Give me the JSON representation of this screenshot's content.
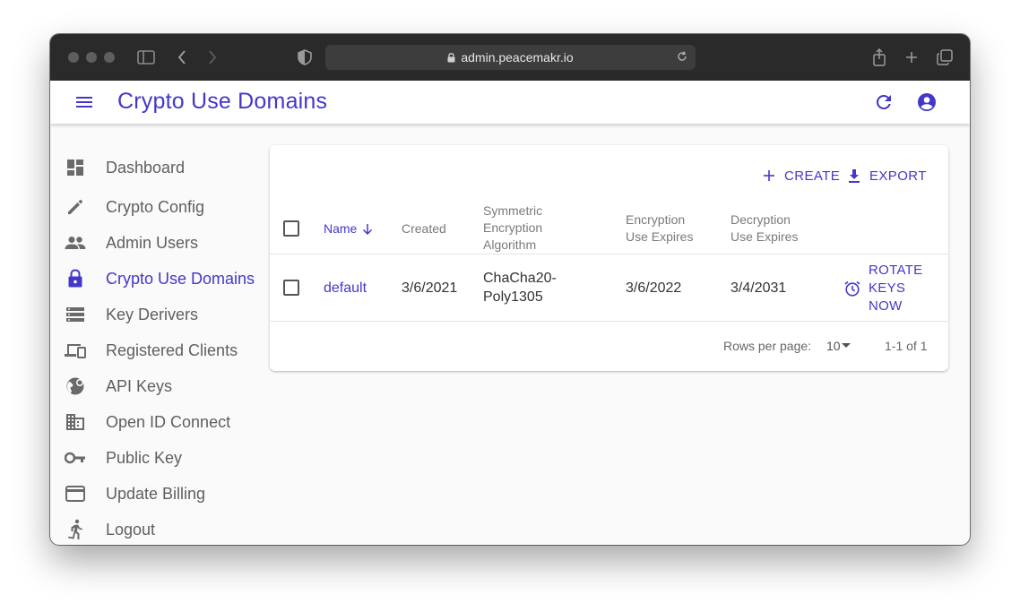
{
  "browser": {
    "url": "admin.peacemakr.io"
  },
  "appbar": {
    "title": "Crypto Use Domains"
  },
  "sidebar": {
    "items": [
      {
        "label": "Dashboard",
        "icon": "dashboard-icon",
        "active": false
      },
      {
        "label": "Crypto Config",
        "icon": "pencil-icon",
        "active": false
      },
      {
        "label": "Admin Users",
        "icon": "people-icon",
        "active": false
      },
      {
        "label": "Crypto Use Domains",
        "icon": "lock-icon",
        "active": true
      },
      {
        "label": "Key Derivers",
        "icon": "storage-icon",
        "active": false
      },
      {
        "label": "Registered Clients",
        "icon": "devices-icon",
        "active": false
      },
      {
        "label": "API Keys",
        "icon": "vpn-globe-icon",
        "active": false
      },
      {
        "label": "Open ID Connect",
        "icon": "business-icon",
        "active": false
      },
      {
        "label": "Public Key",
        "icon": "key-icon",
        "active": false
      },
      {
        "label": "Update Billing",
        "icon": "credit-card-icon",
        "active": false
      },
      {
        "label": "Logout",
        "icon": "running-person-icon",
        "active": false
      }
    ]
  },
  "toolbar": {
    "create_label": "CREATE",
    "export_label": "EXPORT"
  },
  "table": {
    "headers": {
      "name": "Name",
      "created": "Created",
      "algorithm_l1": "Symmetric",
      "algorithm_l2": "Encryption",
      "algorithm_l3": "Algorithm",
      "enc_l1": "Encryption",
      "enc_l2": "Use Expires",
      "dec_l1": "Decryption",
      "dec_l2": "Use Expires"
    },
    "rows": [
      {
        "name": "default",
        "created": "3/6/2021",
        "algorithm_l1": "ChaCha20-",
        "algorithm_l2": "Poly1305",
        "enc_expires": "3/6/2022",
        "dec_expires": "3/4/2031",
        "action_l1": "ROTATE",
        "action_l2": "KEYS",
        "action_l3": "NOW"
      }
    ],
    "footer": {
      "rows_per_page_label": "Rows per page:",
      "rows_per_page_value": "10",
      "range": "1-1 of 1"
    }
  },
  "colors": {
    "accent": "#4338ca",
    "chrome": "#2a2a2a"
  }
}
